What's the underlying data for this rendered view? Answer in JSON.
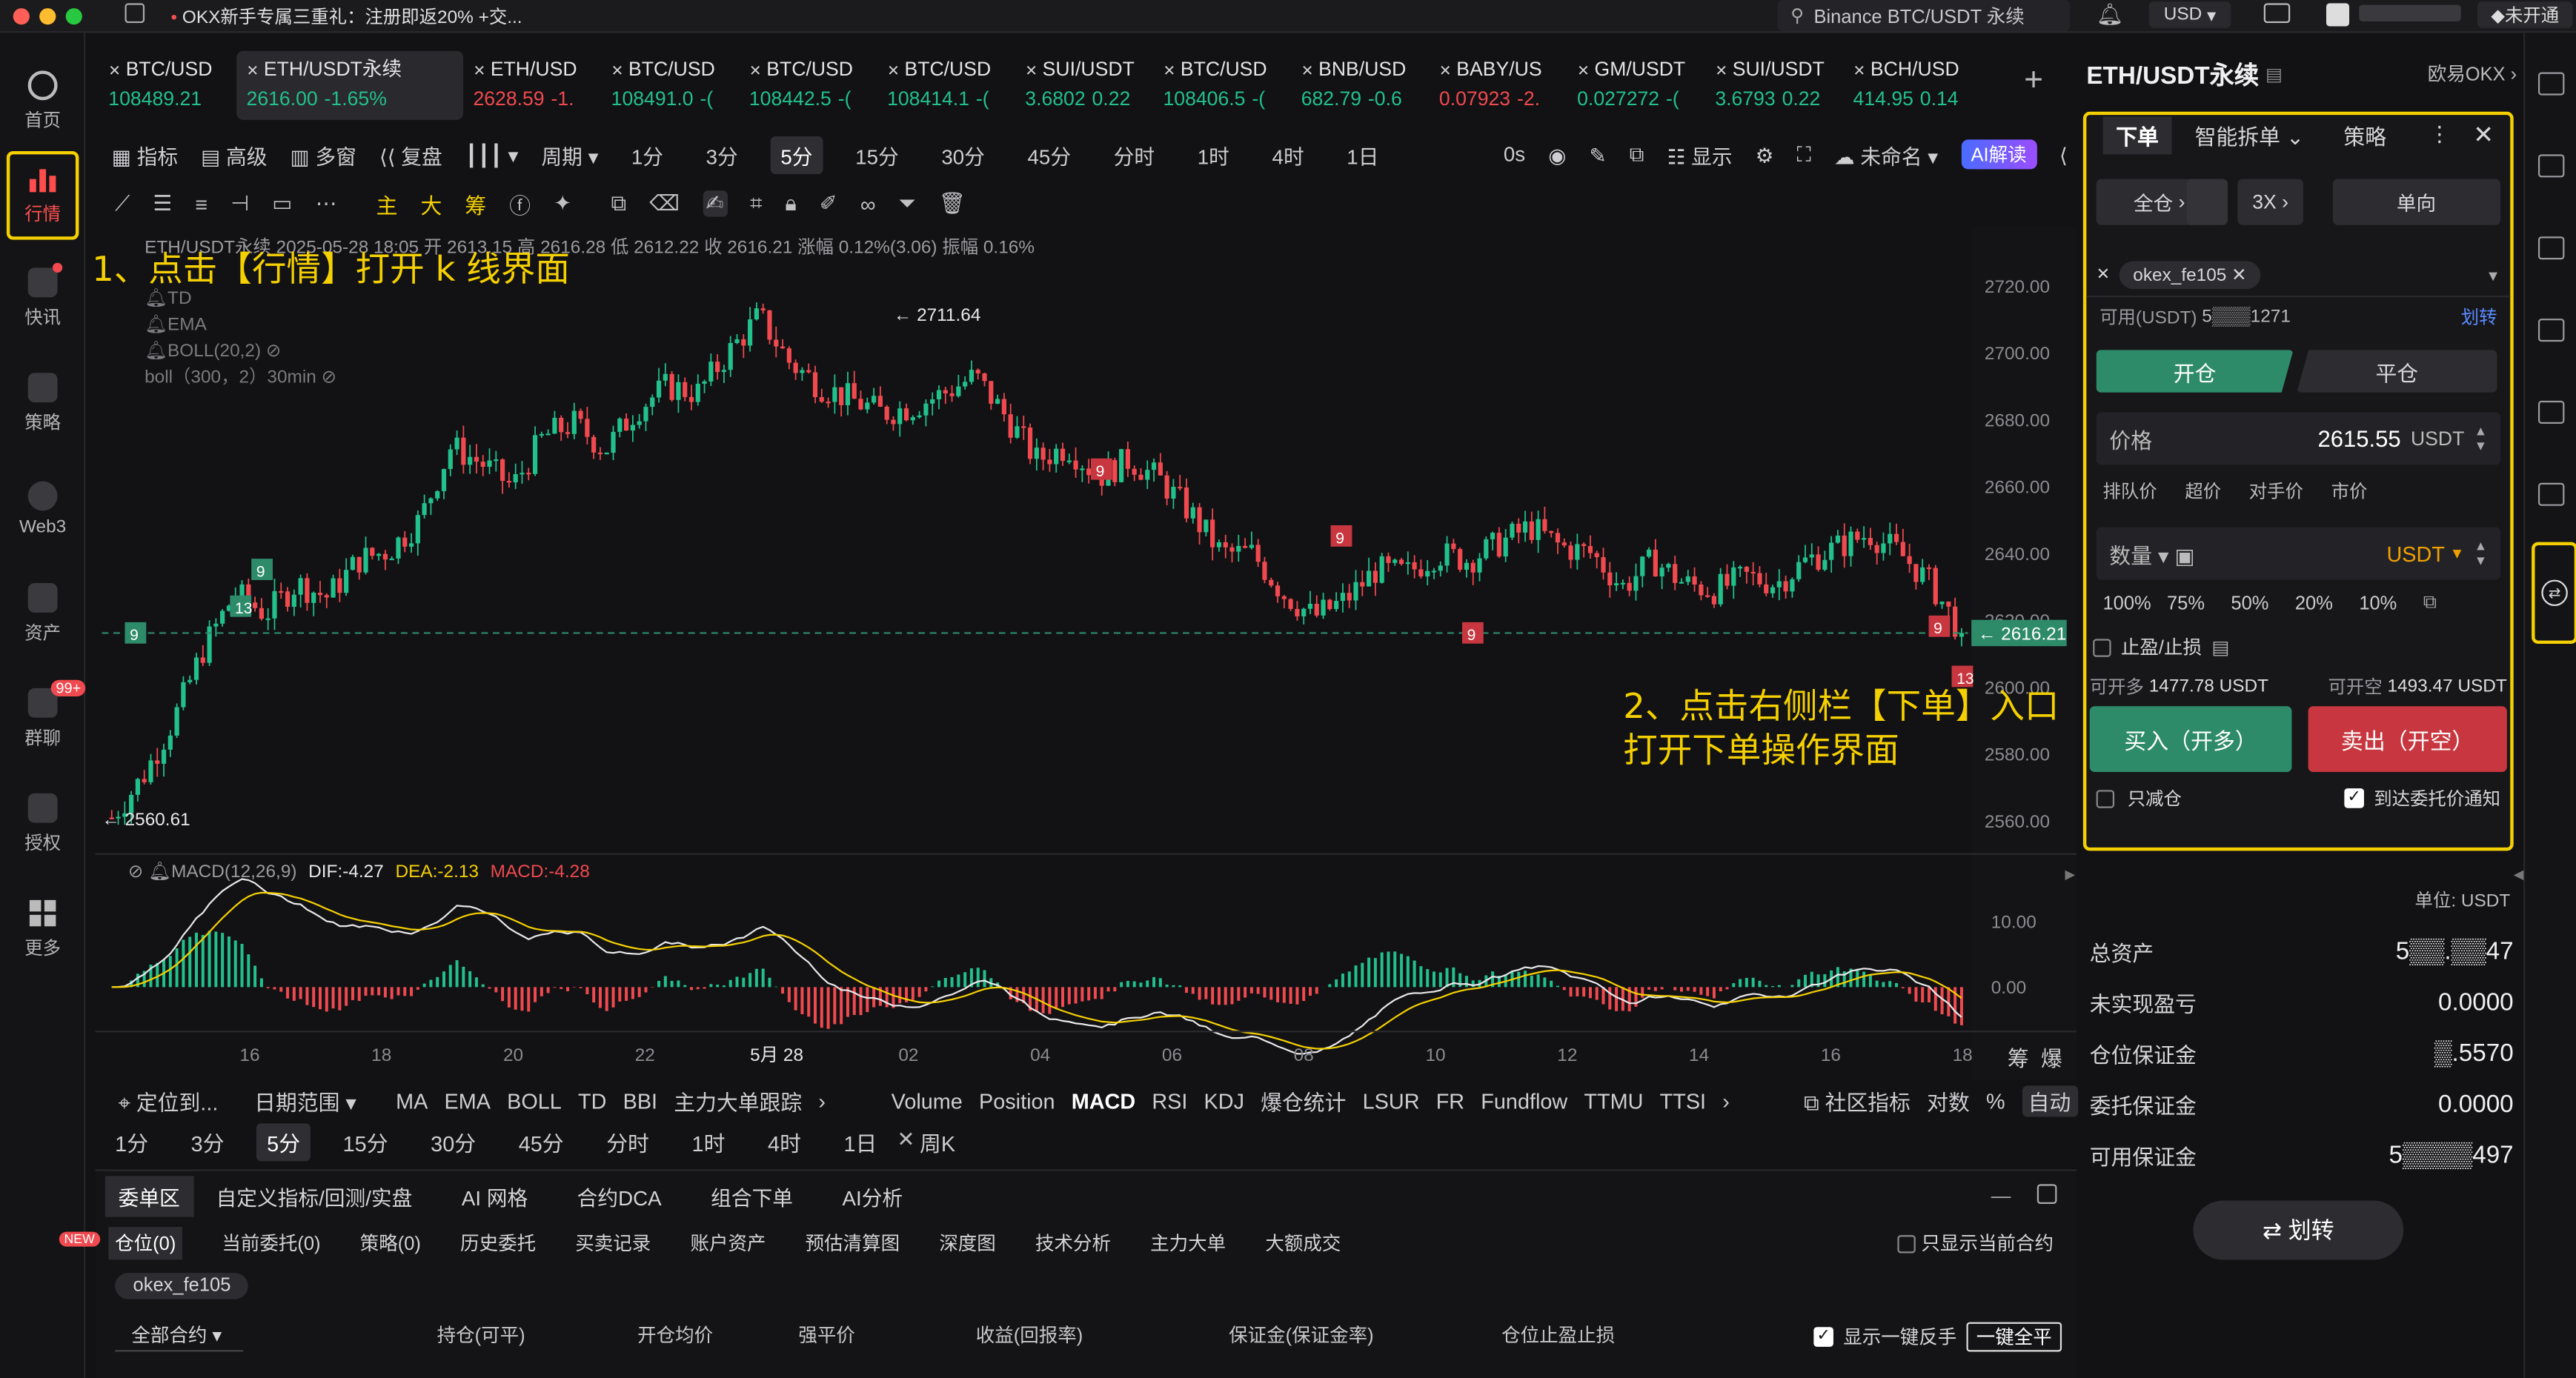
{
  "promo": "OKX新手专属三重礼：注册即返20% +交...",
  "search_placeholder": "Binance BTC/USDT 永续",
  "currency": "USD",
  "account_badge": "未开通",
  "sidebar": [
    {
      "label": "首页"
    },
    {
      "label": "行情"
    },
    {
      "label": "快讯"
    },
    {
      "label": "策略"
    },
    {
      "label": "Web3"
    },
    {
      "label": "资产"
    },
    {
      "label": "群聊",
      "badge": "99+"
    },
    {
      "label": "授权"
    },
    {
      "label": "更多"
    }
  ],
  "tickers": [
    {
      "symbol": "BTC/USD",
      "price": "108489.21",
      "change": "",
      "dir": "up"
    },
    {
      "symbol": "ETH/USDT永续",
      "price": "2616.00",
      "change": "-1.65%",
      "dir": "up"
    },
    {
      "symbol": "ETH/USD",
      "price": "2628.59",
      "change": "-1.",
      "dir": "dn"
    },
    {
      "symbol": "BTC/USD",
      "price": "108491.0",
      "change": "-(",
      "dir": "up"
    },
    {
      "symbol": "BTC/USD",
      "price": "108442.5",
      "change": "-(",
      "dir": "up"
    },
    {
      "symbol": "BTC/USD",
      "price": "108414.1",
      "change": "-(",
      "dir": "up"
    },
    {
      "symbol": "SUI/USDT",
      "price": "3.6802",
      "change": "0.22",
      "dir": "up"
    },
    {
      "symbol": "BTC/USD",
      "price": "108406.5",
      "change": "-(",
      "dir": "up"
    },
    {
      "symbol": "BNB/USD",
      "price": "682.79",
      "change": "-0.6",
      "dir": "up"
    },
    {
      "symbol": "BABY/US",
      "price": "0.07923",
      "change": "-2.",
      "dir": "dn"
    },
    {
      "symbol": "GM/USDT",
      "price": "0.027272",
      "change": "-(",
      "dir": "up"
    },
    {
      "symbol": "SUI/USDT",
      "price": "3.6793",
      "change": "0.22",
      "dir": "up"
    },
    {
      "symbol": "BCH/USD",
      "price": "414.95",
      "change": "0.14",
      "dir": "up"
    }
  ],
  "toolbar": {
    "indicator": "指标",
    "advanced": "高级",
    "multiwin": "多窗",
    "replay": "复盘",
    "period": "周期",
    "timeframes": [
      "1分",
      "3分",
      "5分",
      "15分",
      "30分",
      "45分",
      "分时",
      "1时",
      "4时",
      "1日"
    ],
    "selected_tf": "5分",
    "countdown": "0s",
    "display": "显示",
    "unnamed": "未命名",
    "ai": "AI解读"
  },
  "drawtools": {
    "main": "主",
    "big": "大",
    "chip": "筹"
  },
  "legend": {
    "info": "ETH/USDT永续 2025-05-28 18:05  开 2613.15  高 2616.28  低 2612.22  收 2616.21  涨幅 0.12%(3.06)  振幅 0.16%",
    "td": "TD",
    "ema": "EMA",
    "boll": "BOLL(20,2)",
    "boll2": "boll（300，2）30min"
  },
  "annotations": {
    "step1": "1、点击【行情】打开 k 线界面",
    "step2_a": "2、点击右侧栏【下单】入口",
    "step2_b": "打开下单操作界面"
  },
  "chart_data": {
    "type": "candlestick",
    "y_ticks": [
      "2720.00",
      "2700.00",
      "2680.00",
      "2660.00",
      "2640.00",
      "2620.00",
      "2600.00",
      "2580.00",
      "2560.00"
    ],
    "ylim": [
      2555,
      2725
    ],
    "x_ticks": [
      "16",
      "18",
      "20",
      "22",
      "5月 28",
      "02",
      "04",
      "06",
      "08",
      "10",
      "12",
      "14",
      "16",
      "18"
    ],
    "high_label": "← 2711.64",
    "low_label": "← 2560.61",
    "last_price": "2616.21",
    "td_labels": [
      "9",
      "13",
      "9",
      "9",
      "9",
      "9",
      "9",
      "13"
    ],
    "close_path": [
      2561,
      2573,
      2590,
      2612,
      2628,
      2622,
      2631,
      2627,
      2638,
      2641,
      2650,
      2672,
      2667,
      2660,
      2675,
      2679,
      2671,
      2683,
      2690,
      2688,
      2700,
      2711,
      2697,
      2690,
      2686,
      2682,
      2684,
      2688,
      2693,
      2681,
      2668,
      2672,
      2663,
      2668,
      2662,
      2652,
      2640,
      2640,
      2628,
      2621,
      2626,
      2635,
      2634,
      2640,
      2638,
      2643,
      2648,
      2642,
      2640,
      2630,
      2638,
      2631,
      2629,
      2633,
      2631,
      2638,
      2642,
      2646,
      2640,
      2631,
      2616
    ],
    "macd": {
      "label": "MACD(12,26,9)",
      "dif": "DIF:-4.27",
      "dea": "DEA:-2.13",
      "macd": "MACD:-4.28",
      "ticks": [
        "10.00",
        "0.00"
      ]
    }
  },
  "indicator_bar": {
    "locate": "定位到...",
    "daterange": "日期范围",
    "main": [
      "MA",
      "EMA",
      "BOLL",
      "TD",
      "BBI",
      "主力大单跟踪"
    ],
    "sub": [
      "Volume",
      "Position",
      "MACD",
      "RSI",
      "KDJ",
      "爆仓统计",
      "LSUR",
      "FR",
      "Fundflow",
      "TTMU",
      "TTSI"
    ],
    "community": "社区指标",
    "log": "对数",
    "pct": "%",
    "auto": "自动",
    "chip": "筹",
    "burst": "爆"
  },
  "tf_bar": [
    "1分",
    "3分",
    "5分",
    "15分",
    "30分",
    "45分",
    "分时",
    "1时",
    "4时",
    "1日",
    "周K"
  ],
  "bottom_tabs": [
    "委单区",
    "自定义指标/回测/实盘",
    "AI 网格",
    "合约DCA",
    "组合下单",
    "AI分析"
  ],
  "sub_tabs": [
    "仓位(0)",
    "当前委托(0)",
    "策略(0)",
    "历史委托",
    "买卖记录",
    "账户资产",
    "预估清算图",
    "深度图",
    "技术分析",
    "主力大单",
    "大额成交"
  ],
  "new_badge": "NEW",
  "only_current": "只显示当前合约",
  "account_chip": "okex_fe105",
  "columns": [
    "全部合约",
    "持仓(可平)",
    "开仓均价",
    "强平价",
    "收益(回报率)",
    "保证金(保证金率)",
    "仓位止盈止损"
  ],
  "one_click": {
    "show": "显示一键反手",
    "close_all": "一键全平"
  },
  "right": {
    "symbol": "ETH/USDT永续",
    "exchange": "欧易OKX",
    "tabs": [
      "下单",
      "智能拆单",
      "策略"
    ],
    "margin_mode": "全仓",
    "leverage": "3X",
    "position_mode": "单向",
    "account": "okex_fe105",
    "available_label": "可用(USDT)",
    "available_value": "5▒▒▒1271",
    "transfer": "划转",
    "open": "开仓",
    "close": "平仓",
    "price_label": "价格",
    "price_value": "2615.55",
    "price_unit": "USDT",
    "price_types": [
      "排队价",
      "超价",
      "对手价",
      "市价"
    ],
    "qty_label": "数量",
    "qty_unit": "USDT",
    "pcts": [
      "100%",
      "75%",
      "50%",
      "20%",
      "10%"
    ],
    "tpsl": "止盈/止损",
    "can_long_label": "可开多",
    "can_long": "1477.78",
    "can_short_label": "可开空",
    "can_short": "1493.47",
    "unit": "USDT",
    "buy": "买入（开多）",
    "sell": "卖出（开空）",
    "reduce_only": "只减仓",
    "notify": "到达委托价通知",
    "unit_label": "单位: USDT",
    "assets": [
      {
        "label": "总资产",
        "value": "5▒▒.▒▒47"
      },
      {
        "label": "未实现盈亏",
        "value": "0.0000"
      },
      {
        "label": "仓位保证金",
        "value": "▒.5570"
      },
      {
        "label": "委托保证金",
        "value": "0.0000"
      },
      {
        "label": "可用保证金",
        "value": "5▒▒▒▒497"
      }
    ],
    "transfer_btn": "⇄ 划转"
  },
  "colors": {
    "up": "#22c08a",
    "down": "#f0494f",
    "highlight": "#f5d000",
    "accent_green": "#2e8b6a",
    "accent_red": "#c8373f"
  }
}
